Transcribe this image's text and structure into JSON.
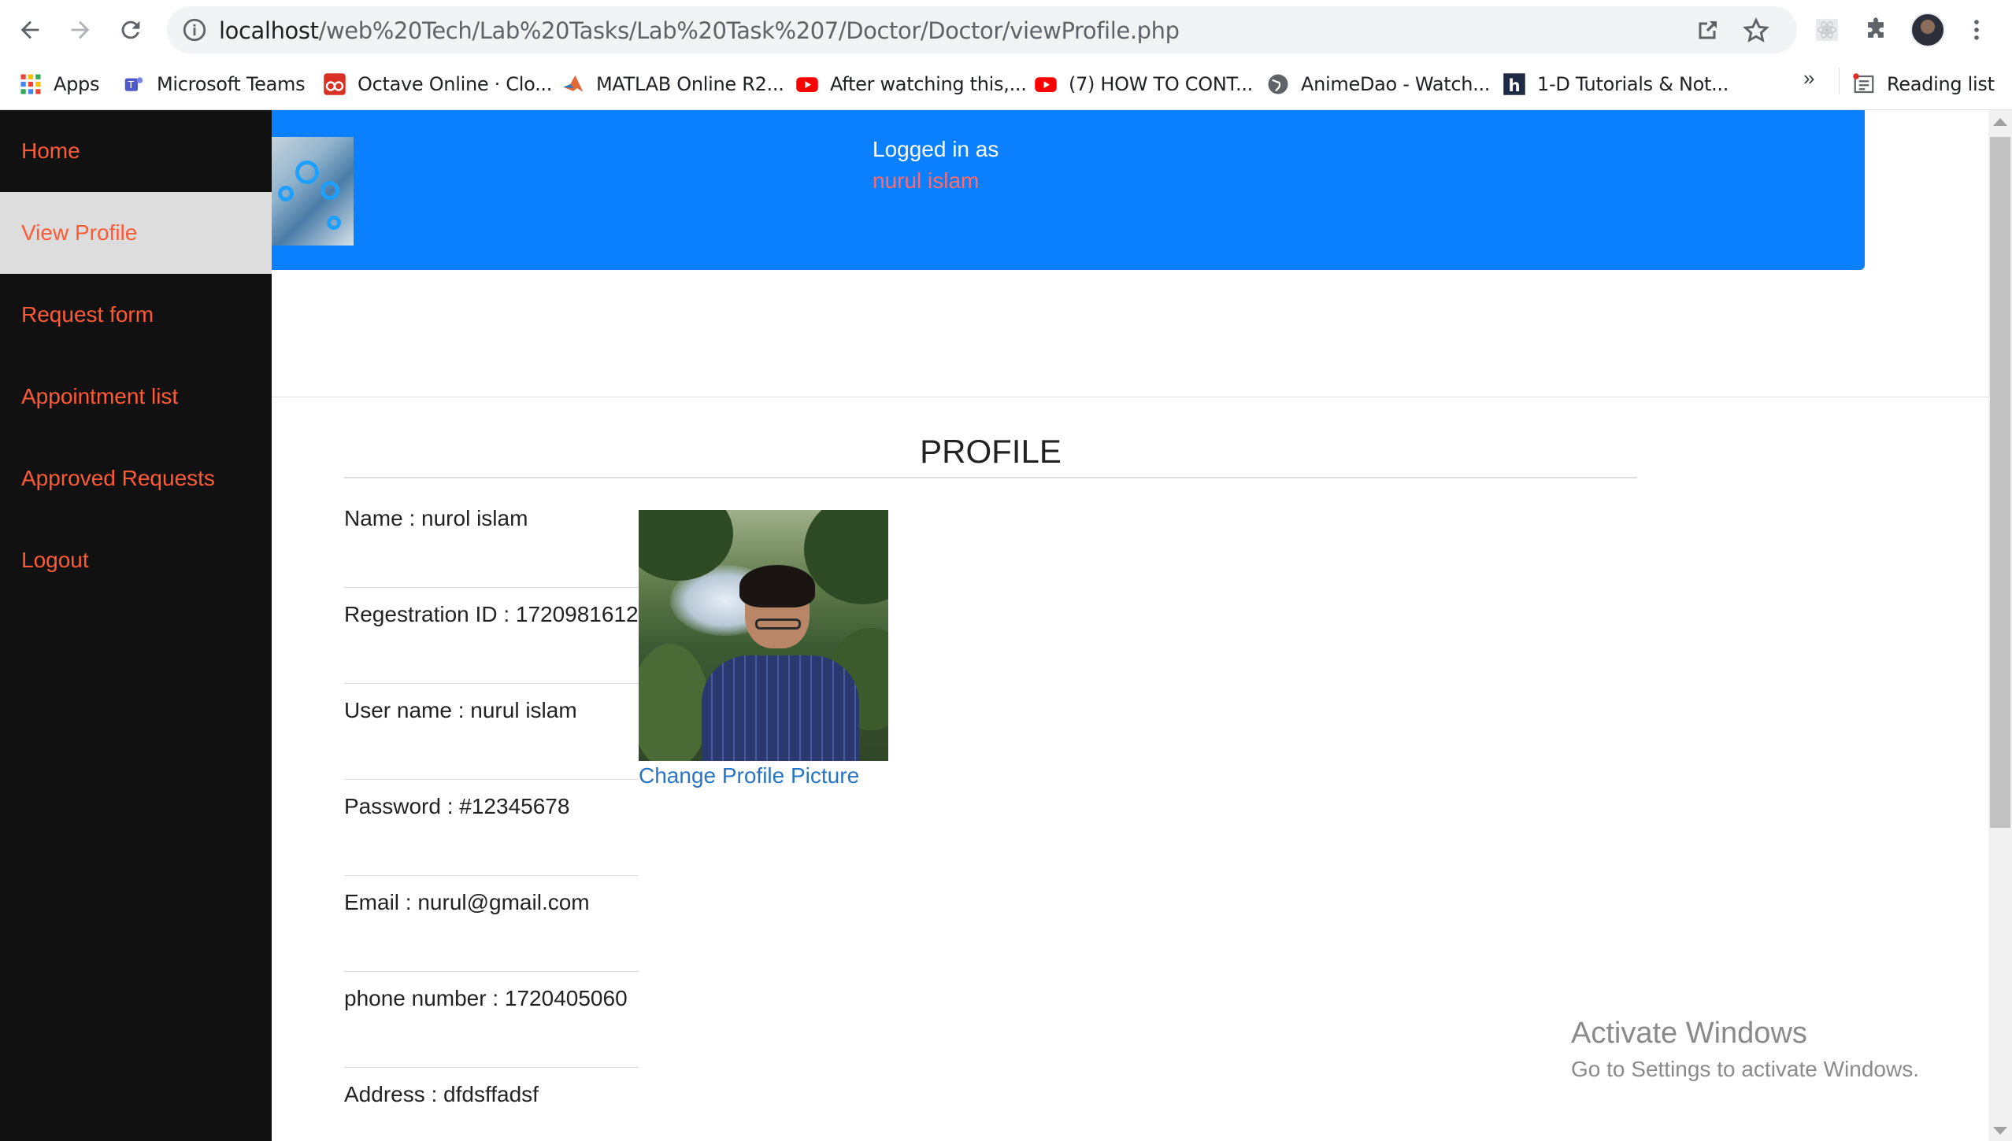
{
  "browser": {
    "url_host": "localhost",
    "url_path": "/web%20Tech/Lab%20Tasks/Lab%20Task%207/Doctor/Doctor/viewProfile.php",
    "bookmarks": [
      {
        "label": "Apps",
        "icon": "apps-grid-icon"
      },
      {
        "label": "Microsoft Teams",
        "icon": "teams-icon"
      },
      {
        "label": "Octave Online · Clo...",
        "icon": "octave-icon"
      },
      {
        "label": "MATLAB Online R2...",
        "icon": "matlab-icon"
      },
      {
        "label": "After watching this,...",
        "icon": "youtube-icon"
      },
      {
        "label": "(7) HOW TO CONT...",
        "icon": "youtube-icon"
      },
      {
        "label": "AnimeDao - Watch...",
        "icon": "globe-icon"
      },
      {
        "label": "1-D Tutorials & Not...",
        "icon": "h-icon"
      }
    ],
    "more_label": "»",
    "reading_list": "Reading list"
  },
  "sidebar": {
    "items": [
      {
        "label": "Home",
        "active": false
      },
      {
        "label": "View Profile",
        "active": true
      },
      {
        "label": "Request form",
        "active": false
      },
      {
        "label": "Appointment list",
        "active": false
      },
      {
        "label": "Approved Requests",
        "active": false
      },
      {
        "label": "Logout",
        "active": false
      }
    ]
  },
  "header": {
    "logged_in_label": "Logged in as",
    "username": "nurul islam"
  },
  "profile": {
    "title": "PROFILE",
    "fields": [
      {
        "text": "Name : nurol islam"
      },
      {
        "text": "Regestration ID : 1720981612"
      },
      {
        "text": "User name : nurul islam"
      },
      {
        "text": "Password : #12345678"
      },
      {
        "text": "Email : nurul@gmail.com"
      },
      {
        "text": "phone number : 1720405060"
      },
      {
        "text": "Address : dfdsffadsf"
      }
    ],
    "change_picture_label": "Change Profile Picture"
  },
  "watermark": {
    "line1": "Activate Windows",
    "line2": "Go to Settings to activate Windows."
  },
  "colors": {
    "sidebar_bg": "#111111",
    "sidebar_text": "#ff5a36",
    "header_bg": "#0a80ff",
    "username": "#ff6a6a",
    "link": "#2a74c4"
  }
}
